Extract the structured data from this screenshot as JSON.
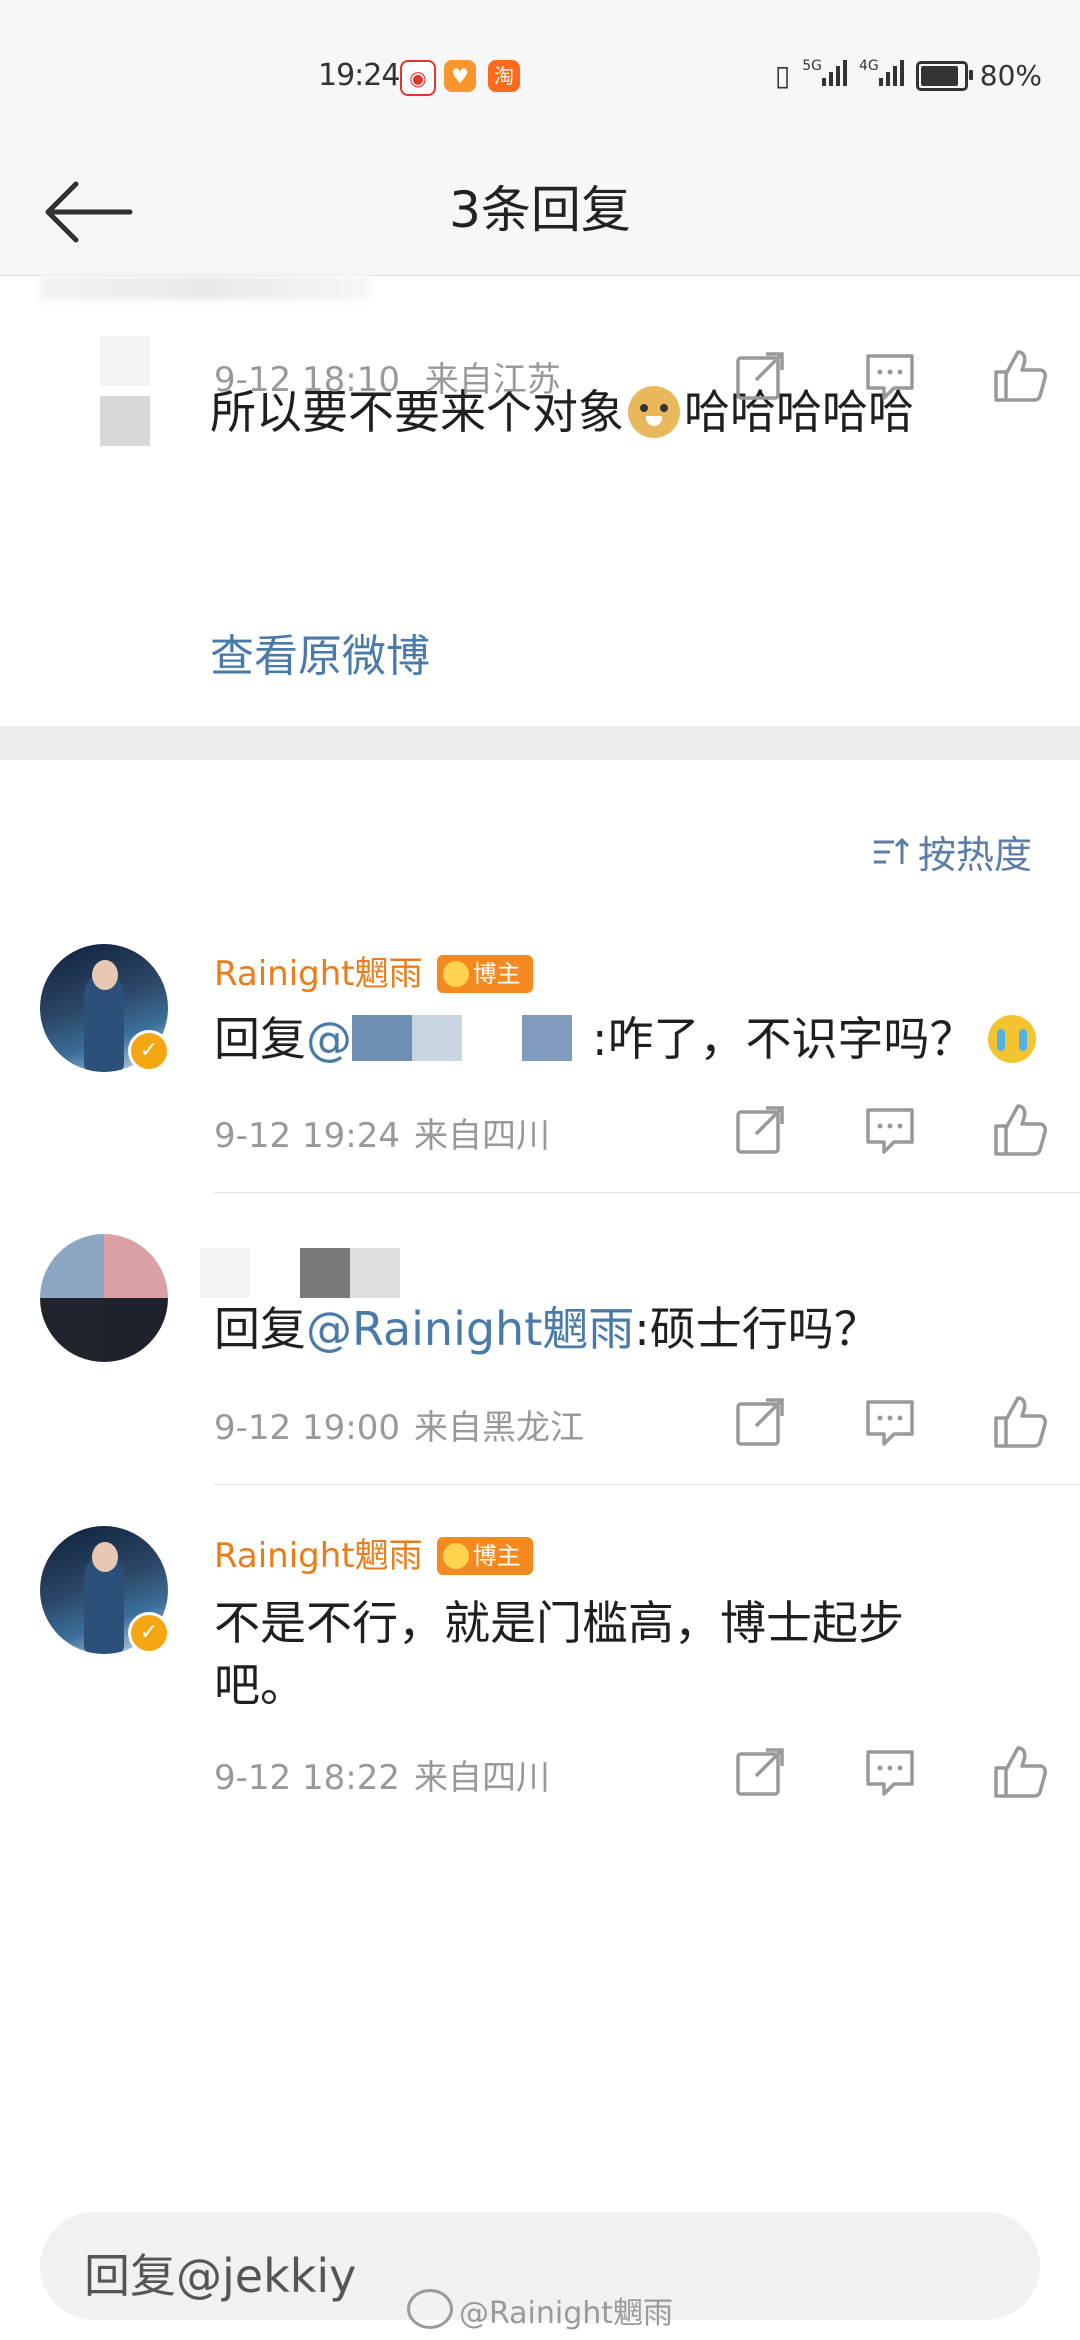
{
  "status_bar": {
    "time": "19:24",
    "network_5g": "5G",
    "network_4g": "4G",
    "battery": "80%",
    "battery_level": 0.8
  },
  "header": {
    "title": "3条回复"
  },
  "original_comment": {
    "text_before": "所以要不要来个对象",
    "text_after": "哈哈哈哈哈",
    "timestamp": "9-12 18:10",
    "location": "来自江苏",
    "view_original_label": "查看原微博"
  },
  "sort": {
    "label": "按热度"
  },
  "replies": [
    {
      "author": "Rainight魍雨",
      "badge": "博主",
      "prefix": "回复",
      "mention_suffix": "@",
      "text": ":咋了，不识字吗？",
      "timestamp": "9-12 19:24",
      "location": "来自四川"
    },
    {
      "author": "",
      "prefix": "回复",
      "mention": "@Rainight魍雨",
      "text": ":硕士行吗？",
      "timestamp": "9-12 19:00",
      "location": "来自黑龙江"
    },
    {
      "author": "Rainight魍雨",
      "badge": "博主",
      "text_line1": "不是不行，就是门槛高，博士起步",
      "text_line2": "吧。",
      "timestamp": "9-12 18:22",
      "location": "来自四川"
    }
  ],
  "input": {
    "value": "回复@jekkiy"
  },
  "watermark": {
    "text": "@Rainight魍雨"
  },
  "colors": {
    "link": "#4a7aa8",
    "author": "#e97d1a",
    "badge": "#f48a1f",
    "verified": "#f4a712"
  }
}
